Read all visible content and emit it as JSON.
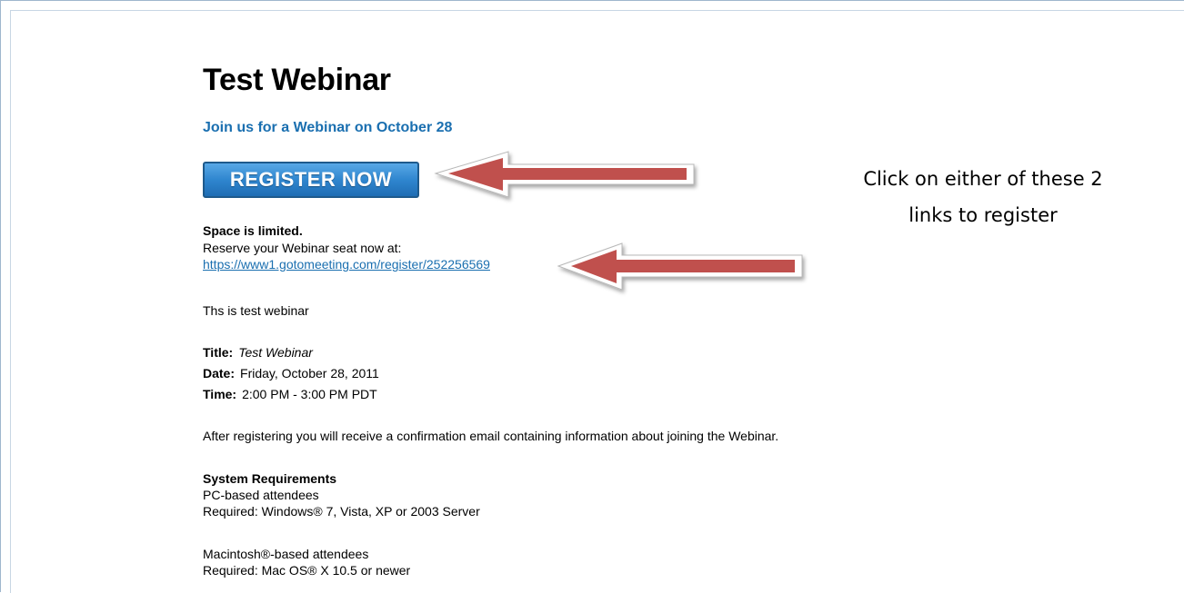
{
  "webinar": {
    "title": "Test Webinar",
    "subtitle": "Join us for a Webinar on October 28",
    "register_button": "REGISTER NOW",
    "space_limited": "Space is limited.",
    "reserve_text": "Reserve your Webinar seat now at:",
    "register_link": "https://www1.gotomeeting.com/register/252256569",
    "description": "Ths is test  webinar",
    "details": {
      "title_label": "Title:",
      "title_value": "Test Webinar",
      "date_label": "Date:",
      "date_value": "Friday, October 28, 2011",
      "time_label": "Time:",
      "time_value": "2:00 PM - 3:00 PM PDT"
    },
    "after_registering": "After registering you will receive a confirmation email containing information about joining the Webinar.",
    "system_requirements": {
      "heading": "System Requirements",
      "pc_label": "PC-based attendees",
      "pc_required": "Required: Windows® 7, Vista, XP or 2003 Server",
      "mac_label": "Macintosh®-based attendees",
      "mac_required": "Required: Mac OS® X 10.5 or newer"
    }
  },
  "annotation": {
    "line1": "Click on either of these 2",
    "line2": "links to register"
  },
  "colors": {
    "link_blue": "#1a6fb0",
    "button_blue": "#2f86cf",
    "arrow_red": "#c0504d"
  }
}
